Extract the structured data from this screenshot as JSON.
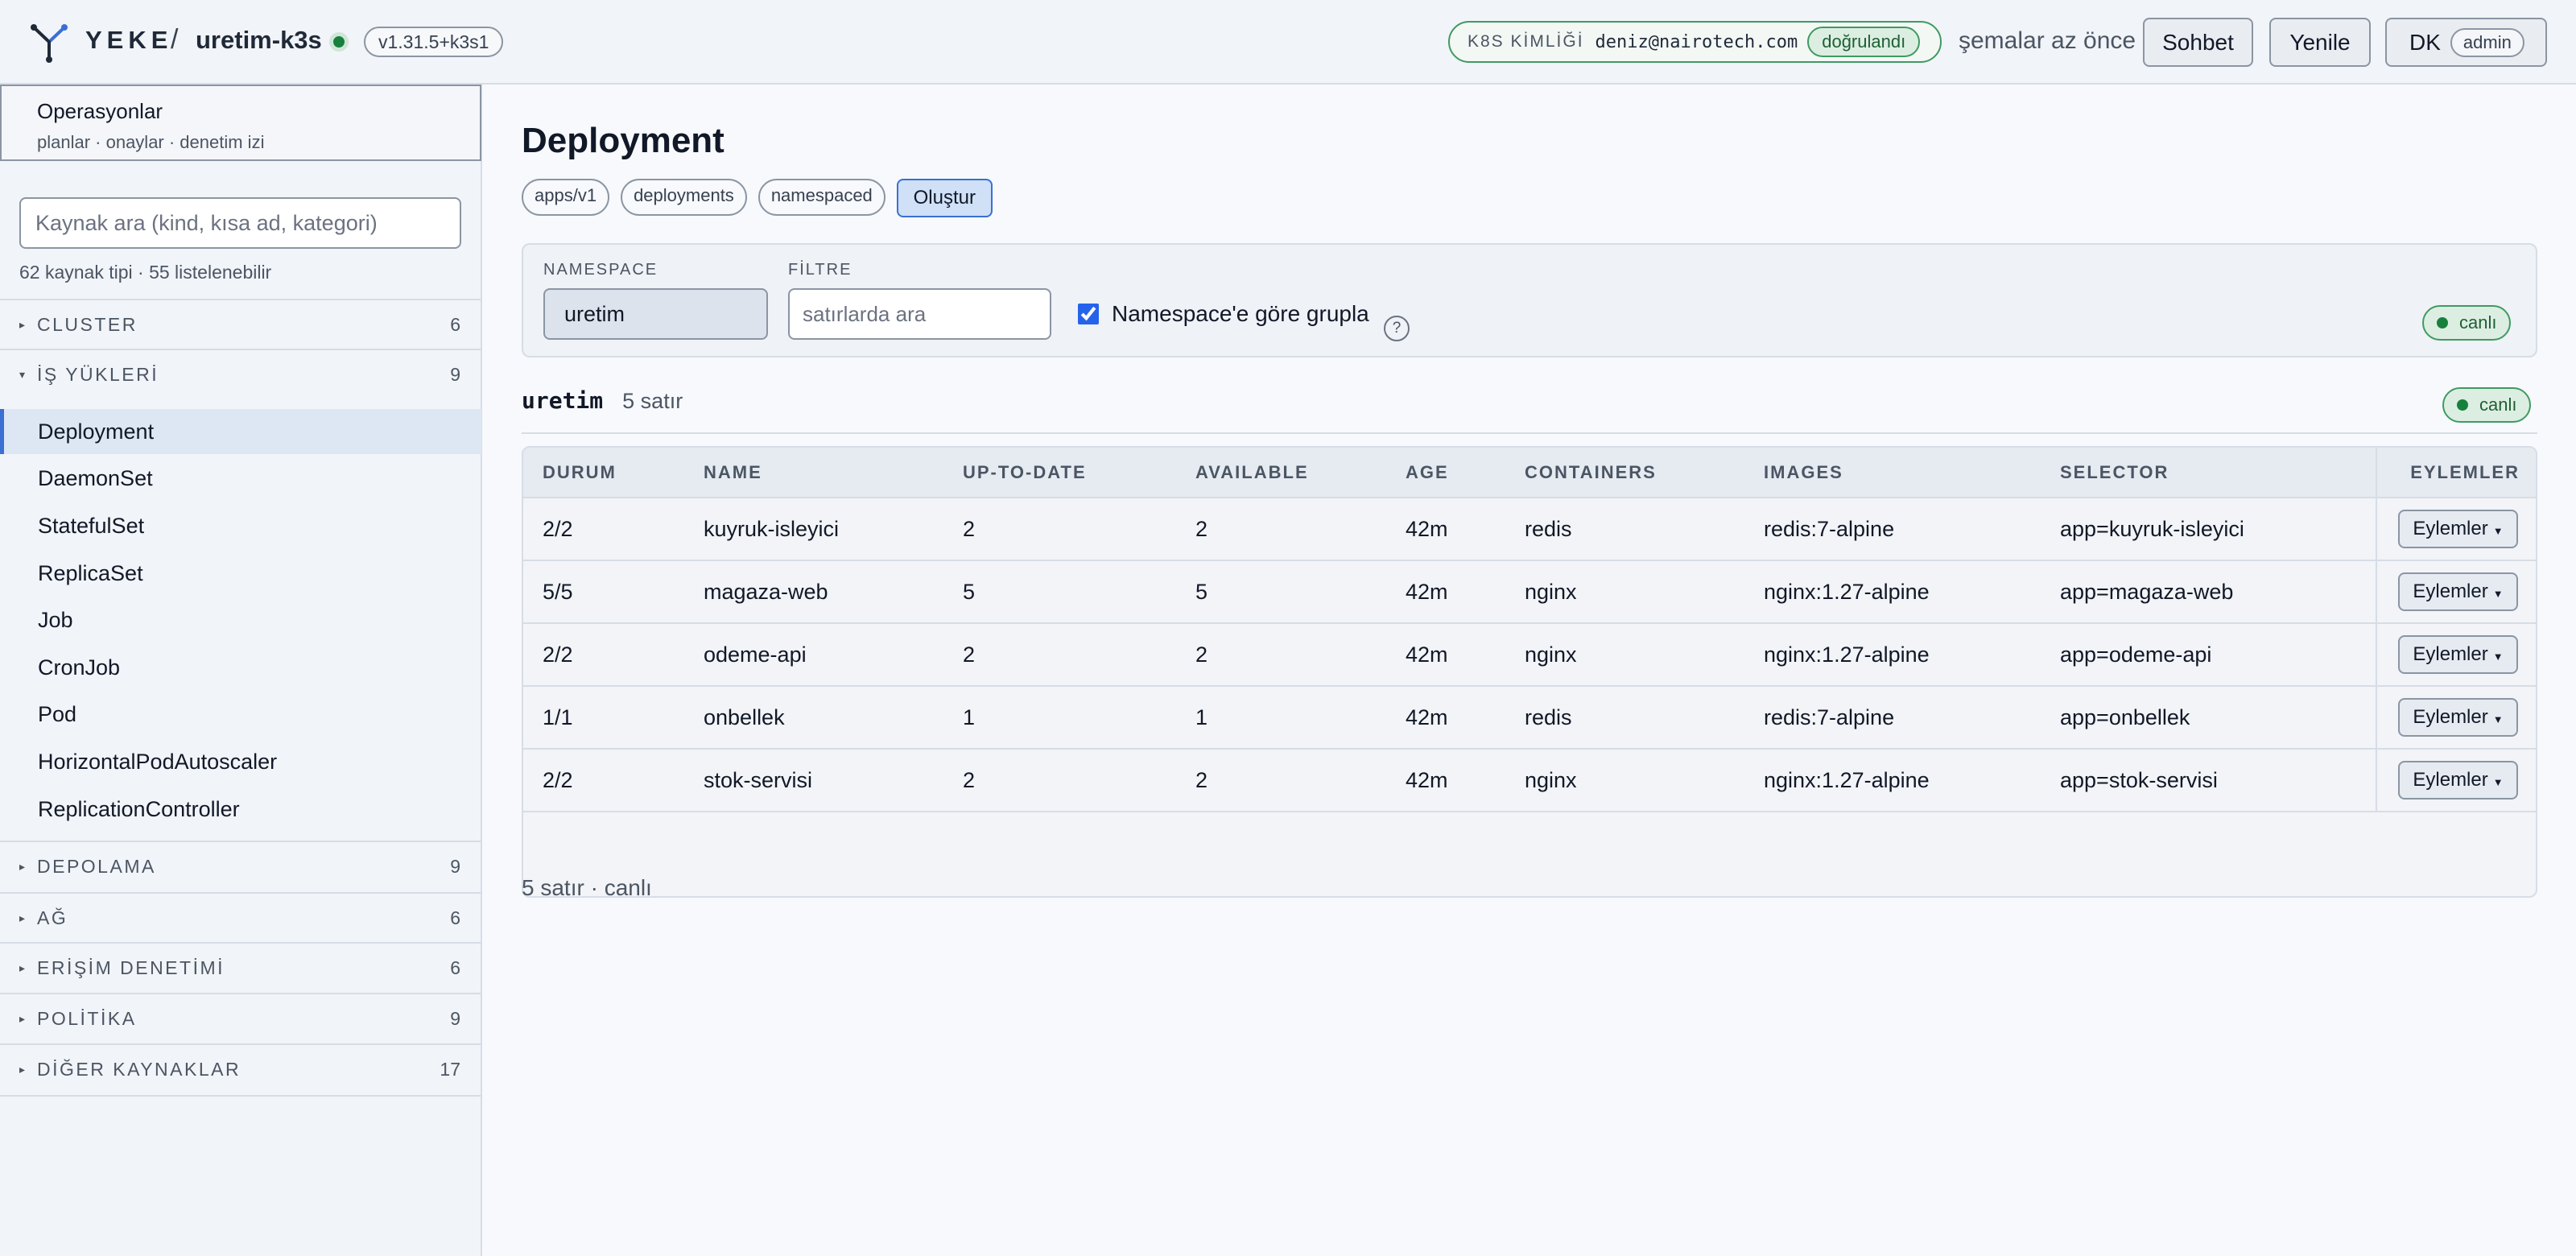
{
  "header": {
    "brand": "YEKE",
    "separator": "/",
    "cluster": "uretim-k3s",
    "version": "v1.31.5+k3s1",
    "identity_label": "K8S KİMLİĞİ",
    "identity_email": "deniz@nairotech.com",
    "identity_status": "doğrulandı",
    "schemas_status": "şemalar az önce",
    "chat_label": "Sohbet",
    "refresh_label": "Yenile",
    "user_initials": "DK",
    "user_role": "admin"
  },
  "sidebar": {
    "ops_title": "Operasyonlar",
    "ops_subtitle": "planlar · onaylar · denetim izi",
    "search_placeholder": "Kaynak ara (kind, kısa ad, kategori)",
    "counts": "62 kaynak tipi · 55 listelenebilir",
    "groups": [
      {
        "name": "CLUSTER",
        "count": "6",
        "expanded": false
      },
      {
        "name": "İŞ YÜKLERİ",
        "count": "9",
        "expanded": true
      },
      {
        "name": "DEPOLAMA",
        "count": "9",
        "expanded": false
      },
      {
        "name": "AĞ",
        "count": "6",
        "expanded": false
      },
      {
        "name": "ERİŞİM DENETİMİ",
        "count": "6",
        "expanded": false
      },
      {
        "name": "POLİTİKA",
        "count": "9",
        "expanded": false
      },
      {
        "name": "DİĞER KAYNAKLAR",
        "count": "17",
        "expanded": false
      }
    ],
    "workload_items": [
      "Deployment",
      "DaemonSet",
      "StatefulSet",
      "ReplicaSet",
      "Job",
      "CronJob",
      "Pod",
      "HorizontalPodAutoscaler",
      "ReplicationController"
    ],
    "active_item": "Deployment"
  },
  "main": {
    "title": "Deployment",
    "chips": [
      "apps/v1",
      "deployments",
      "namespaced"
    ],
    "create_label": "Oluştur",
    "namespace_label": "NAMESPACE",
    "namespace_value": "uretim",
    "filter_label": "FİLTRE",
    "filter_placeholder": "satırlarda ara",
    "group_label": "Namespace'e göre grupla",
    "group_checked": true,
    "help": "?",
    "live_label": "canlı",
    "section_ns": "uretim",
    "section_rows": "5 satır",
    "footer": "5 satır · canlı"
  },
  "table": {
    "columns": [
      "DURUM",
      "NAME",
      "UP-TO-DATE",
      "AVAILABLE",
      "AGE",
      "CONTAINERS",
      "IMAGES",
      "SELECTOR",
      "EYLEMLER"
    ],
    "action_label": "Eylemler",
    "rows": [
      {
        "durum": "2/2",
        "name": "kuyruk-isleyici",
        "uptodate": "2",
        "available": "2",
        "age": "42m",
        "containers": "redis",
        "images": "redis:7-alpine",
        "selector": "app=kuyruk-isleyici"
      },
      {
        "durum": "5/5",
        "name": "magaza-web",
        "uptodate": "5",
        "available": "5",
        "age": "42m",
        "containers": "nginx",
        "images": "nginx:1.27-alpine",
        "selector": "app=magaza-web"
      },
      {
        "durum": "2/2",
        "name": "odeme-api",
        "uptodate": "2",
        "available": "2",
        "age": "42m",
        "containers": "nginx",
        "images": "nginx:1.27-alpine",
        "selector": "app=odeme-api"
      },
      {
        "durum": "1/1",
        "name": "onbellek",
        "uptodate": "1",
        "available": "1",
        "age": "42m",
        "containers": "redis",
        "images": "redis:7-alpine",
        "selector": "app=onbellek"
      },
      {
        "durum": "2/2",
        "name": "stok-servisi",
        "uptodate": "2",
        "available": "2",
        "age": "42m",
        "containers": "nginx",
        "images": "nginx:1.27-alpine",
        "selector": "app=stok-servisi"
      }
    ]
  },
  "colors": {
    "accent": "#3b6fd4",
    "status_green": "#17803d",
    "background": "#f7f9fc",
    "sidebar_bg": "#f1f4f8"
  },
  "icons": {
    "logo": "yeke-logo-icon",
    "cluster_status": "status-dot-icon",
    "help": "help-icon",
    "expand": "chevron-right-icon",
    "collapse": "chevron-down-icon"
  }
}
